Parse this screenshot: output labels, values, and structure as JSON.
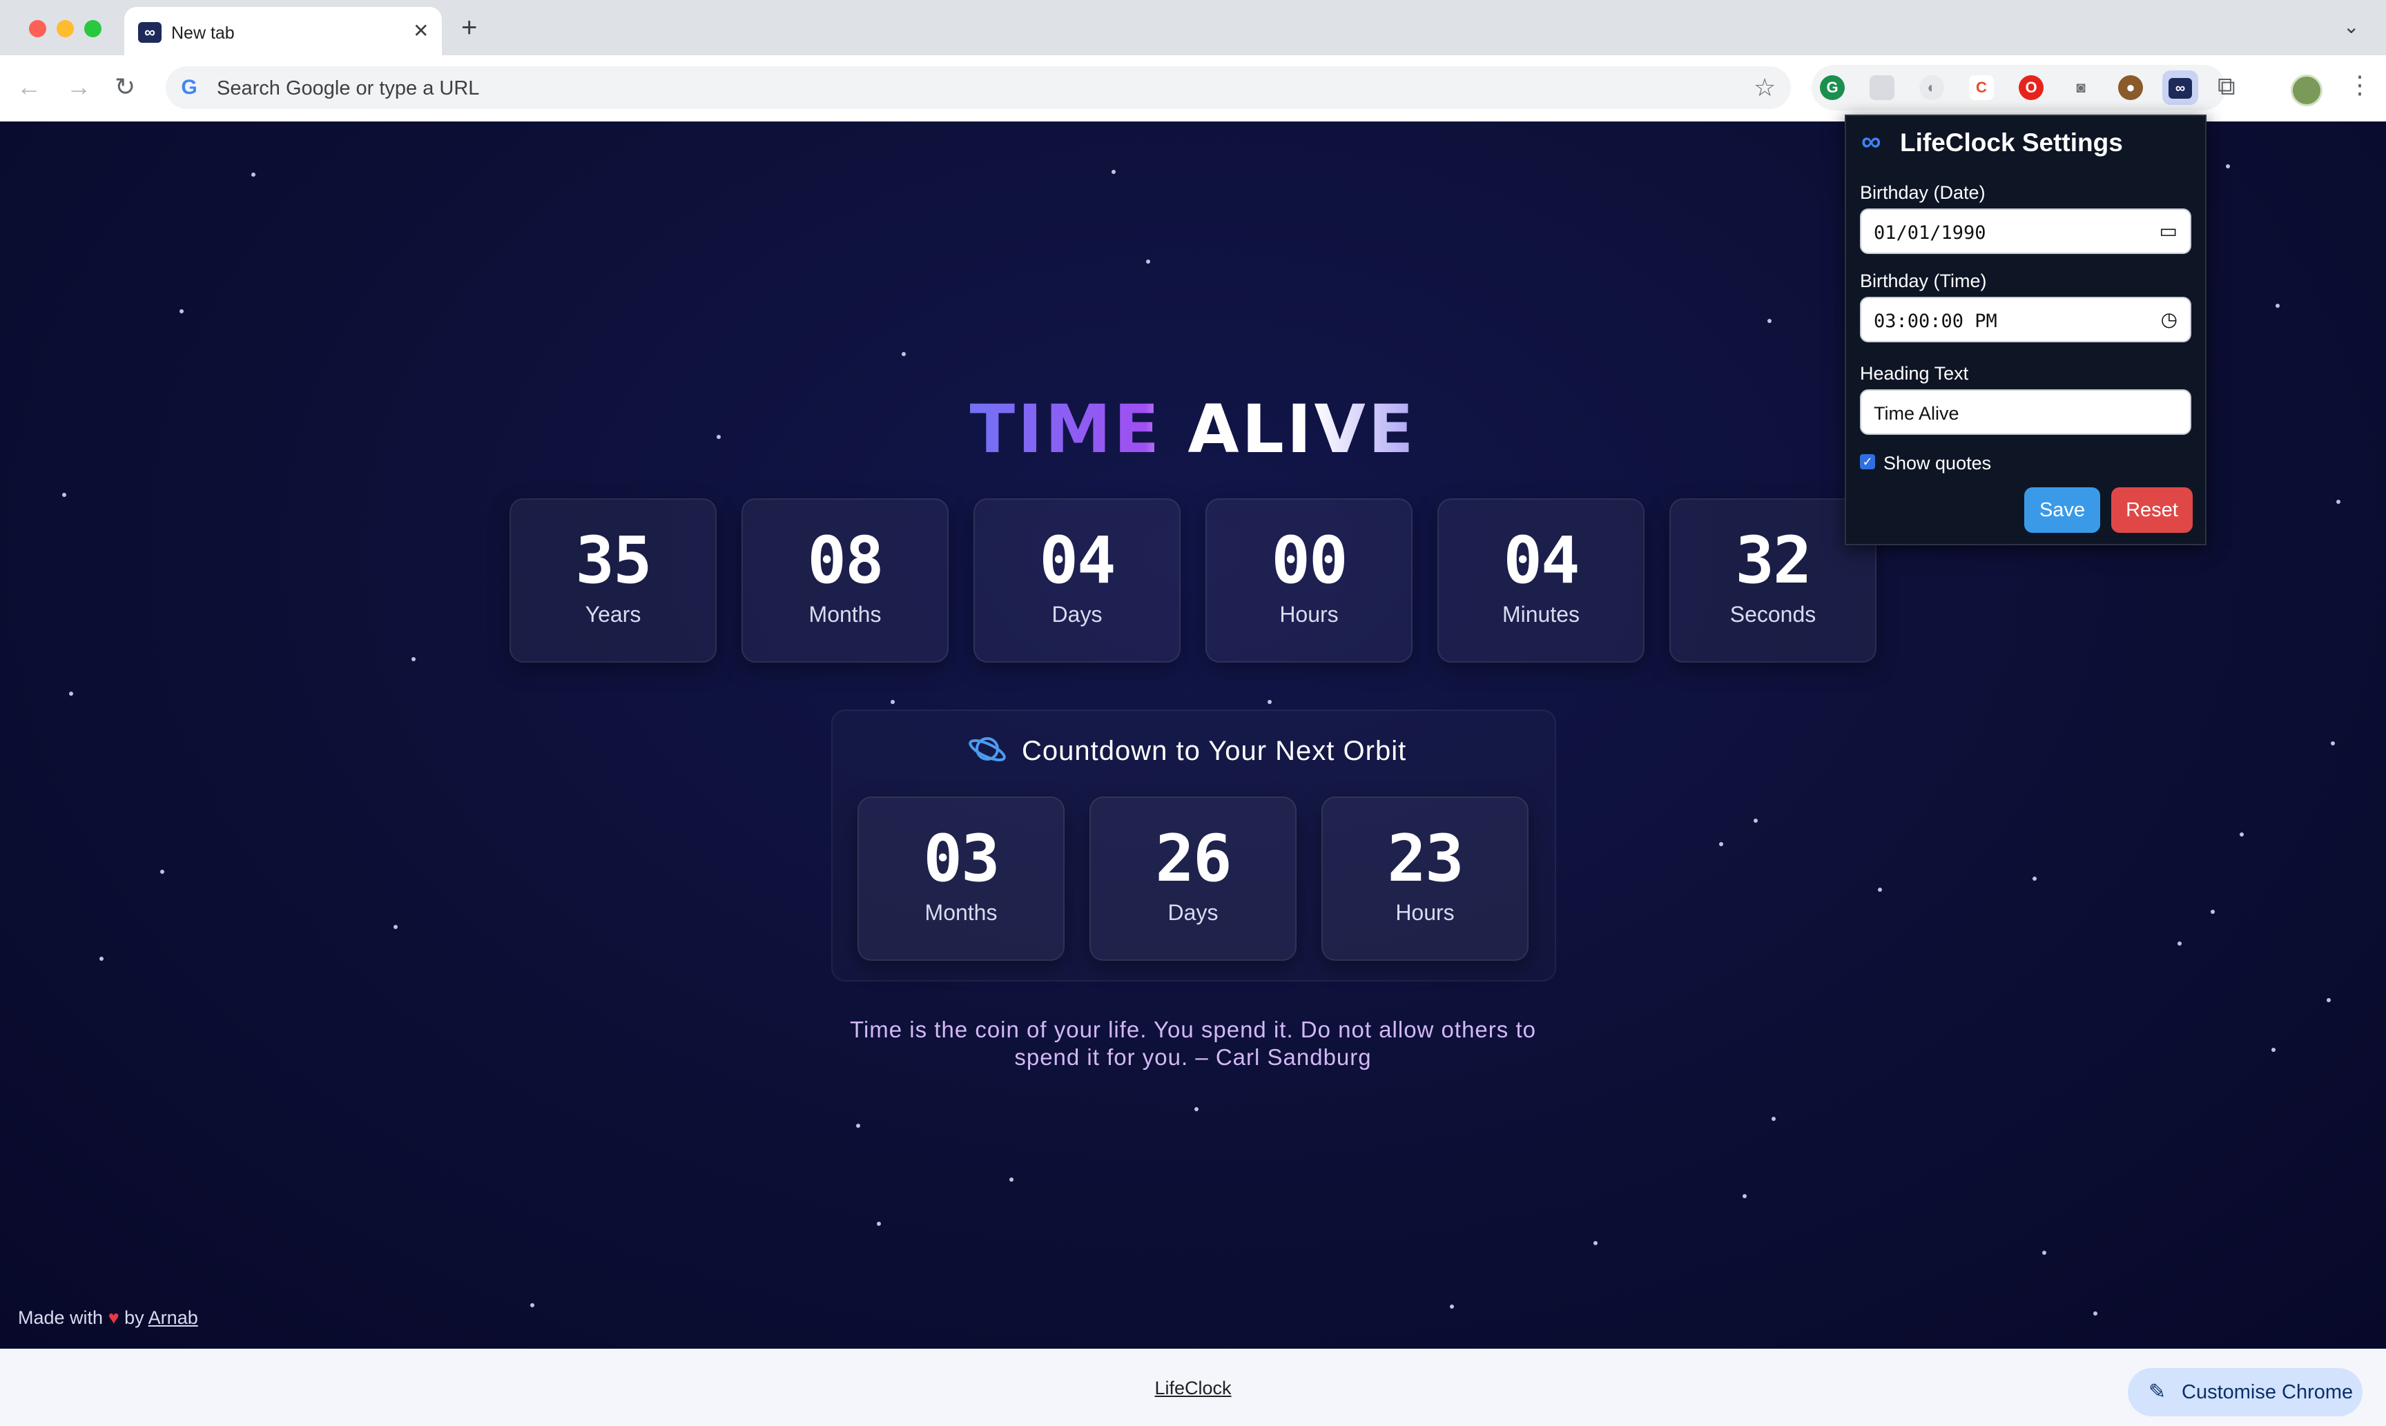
{
  "browser": {
    "tab_title": "New tab",
    "tab_close_glyph": "✕",
    "new_tab_glyph": "+",
    "tab_menu_glyph": "⌄",
    "omnibox_placeholder": "Search Google or type a URL",
    "nav_back_glyph": "←",
    "nav_forward_glyph": "→",
    "nav_reload_glyph": "↻",
    "star_glyph": "☆",
    "menu_glyph": "⋮",
    "puzzle_glyph": "⧉",
    "google_glyph": "G",
    "extensions": [
      "grammarly-icon",
      "extension-icon",
      "extension-icon",
      "extension-icon",
      "opera-icon",
      "camera-icon",
      "cookie-icon",
      "lifeclock-icon"
    ]
  },
  "page": {
    "heading": "TIME ALIVE",
    "time_alive": [
      {
        "value": "35",
        "label": "Years"
      },
      {
        "value": "08",
        "label": "Months"
      },
      {
        "value": "04",
        "label": "Days"
      },
      {
        "value": "00",
        "label": "Hours"
      },
      {
        "value": "04",
        "label": "Minutes"
      },
      {
        "value": "32",
        "label": "Seconds"
      }
    ],
    "countdown_title": "Countdown to Your Next Orbit",
    "countdown": [
      {
        "value": "03",
        "label": "Months"
      },
      {
        "value": "26",
        "label": "Days"
      },
      {
        "value": "23",
        "label": "Hours"
      }
    ],
    "quote_line1": "Time is the coin of your life. You spend it. Do not allow others to",
    "quote_line2": "spend it for you. – Carl Sandburg",
    "made_with_prefix": "Made with",
    "made_with_heart": "♥",
    "made_with_by": "by",
    "author": "Arnab"
  },
  "popup": {
    "title": "LifeClock Settings",
    "icon_glyph": "∞",
    "birthday_date_label": "Birthday (Date)",
    "birthday_date_value": "01/01/1990",
    "birthday_time_label": "Birthday (Time)",
    "birthday_time_value": "03:00:00 PM",
    "heading_text_label": "Heading Text",
    "heading_text_value": "Time Alive",
    "show_quotes_label": "Show quotes",
    "show_quotes_checked": true,
    "save_label": "Save",
    "reset_label": "Reset"
  },
  "footer": {
    "link_text": "LifeClock",
    "customise_label": "Customise Chrome",
    "customise_glyph": "✎"
  },
  "colors": {
    "page_bg": "#0b0d2e",
    "accent_blue": "#3b9ae8",
    "reset_red": "#e04848",
    "heading_purple": "#7b3ff2"
  }
}
